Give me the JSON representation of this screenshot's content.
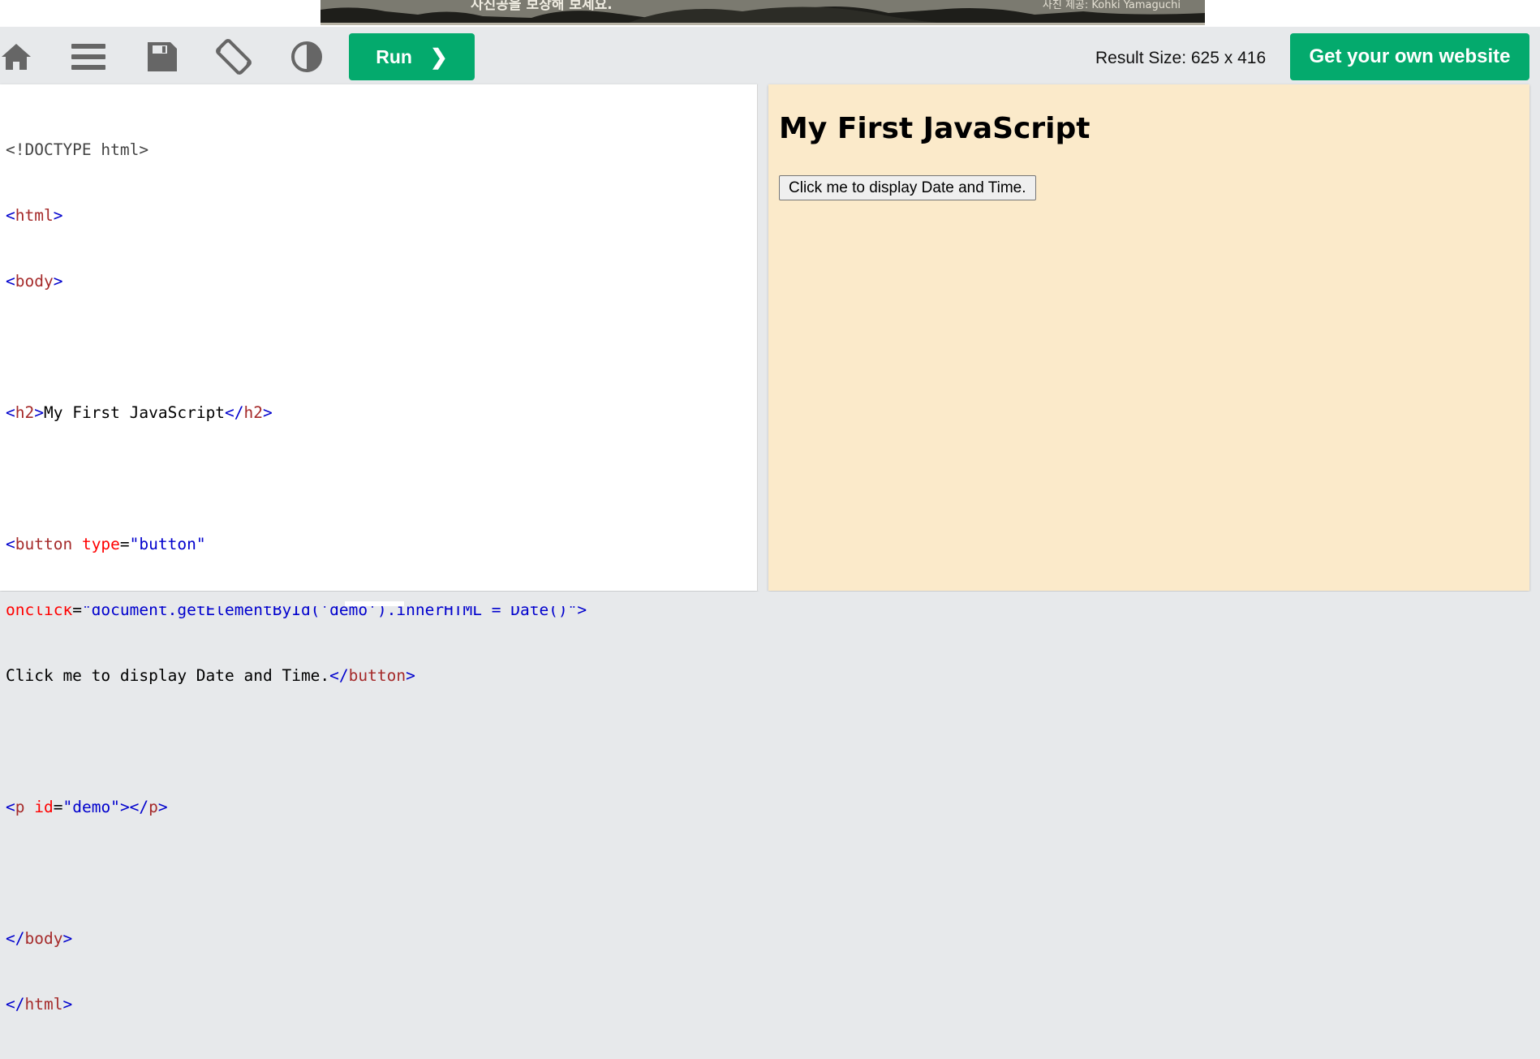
{
  "banner": {
    "left_text": "사진공을 보장해 보세요.",
    "credit_text": "사진 제공: Kohki Yamaguchi",
    "bg_color": "#5a5a50"
  },
  "toolbar": {
    "icons": [
      "home-icon",
      "menu-icon",
      "save-icon",
      "rotate-icon",
      "contrast-icon"
    ],
    "run_label": "Run",
    "run_chevron": "❯",
    "result_size_text": "Result Size: 625 x 416",
    "get_website_label": "Get your own website",
    "accent_color": "#04aa6d"
  },
  "editor": {
    "code_lines": [
      "<!DOCTYPE html>",
      "<html>",
      "<body>",
      "",
      "<h2>My First JavaScript</h2>",
      "",
      "<button type=\"button\"",
      "onclick=\"document.getElementById('demo').innerHTML = Date()\">",
      "Click me to display Date and Time.</button>",
      "",
      "<p id=\"demo\"></p>",
      "",
      "</body>",
      "</html>"
    ]
  },
  "result": {
    "heading": "My First JavaScript",
    "button_label": "Click me to display Date and Time.",
    "demo_text": "",
    "bg_color": "#fbeaca"
  }
}
